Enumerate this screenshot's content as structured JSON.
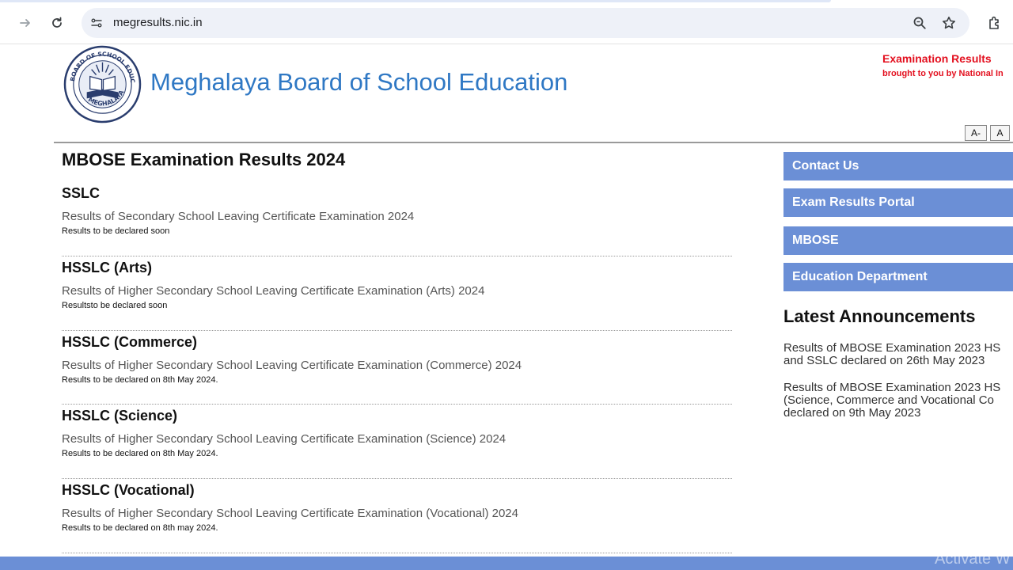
{
  "browser": {
    "url": "megresults.nic.in"
  },
  "header": {
    "logo_text_top": "BOARD OF SCHOOL EDUCATION",
    "logo_text_bottom": "MEGHALAYA",
    "title": "Meghalaya Board of School Education",
    "right_line1": "Examination Results",
    "right_line2": "brought to you by National In",
    "font_decrease": "A-",
    "font_normal": "A"
  },
  "main": {
    "title": "MBOSE Examination Results 2024",
    "results": [
      {
        "heading": "SSLC",
        "description": "Results of Secondary School Leaving Certificate Examination 2024",
        "note": "Results to be declared soon"
      },
      {
        "heading": "HSSLC (Arts)",
        "description": "Results of Higher Secondary School Leaving Certificate Examination (Arts) 2024",
        "note": "Resultsto be declared soon"
      },
      {
        "heading": "HSSLC (Commerce)",
        "description": "Results of Higher Secondary School Leaving Certificate Examination (Commerce) 2024",
        "note": "Results to be declared on 8th May 2024."
      },
      {
        "heading": "HSSLC (Science)",
        "description": "Results of Higher Secondary School Leaving Certificate Examination (Science) 2024",
        "note": "Results to be declared on 8th May 2024."
      },
      {
        "heading": "HSSLC (Vocational)",
        "description": "Results of Higher Secondary School Leaving Certificate Examination (Vocational) 2024",
        "note": "Results to be declared on 8th may 2024."
      }
    ]
  },
  "sidebar": {
    "links": [
      "Contact Us",
      "Exam Results Portal",
      "MBOSE",
      "Education Department"
    ],
    "announcements_title": "Latest Announcements",
    "announcements": [
      [
        "Results of MBOSE Examination 2023 HS",
        "and SSLC declared on 26th May 2023"
      ],
      [
        "Results of MBOSE Examination 2023 HS",
        "(Science, Commerce and Vocational Co",
        "declared on 9th May 2023"
      ]
    ]
  },
  "watermark": "Activate W",
  "colors": {
    "title_blue": "#2f78c4",
    "accent_red": "#e3101f",
    "sidebar_blue": "#6b8fd6"
  }
}
